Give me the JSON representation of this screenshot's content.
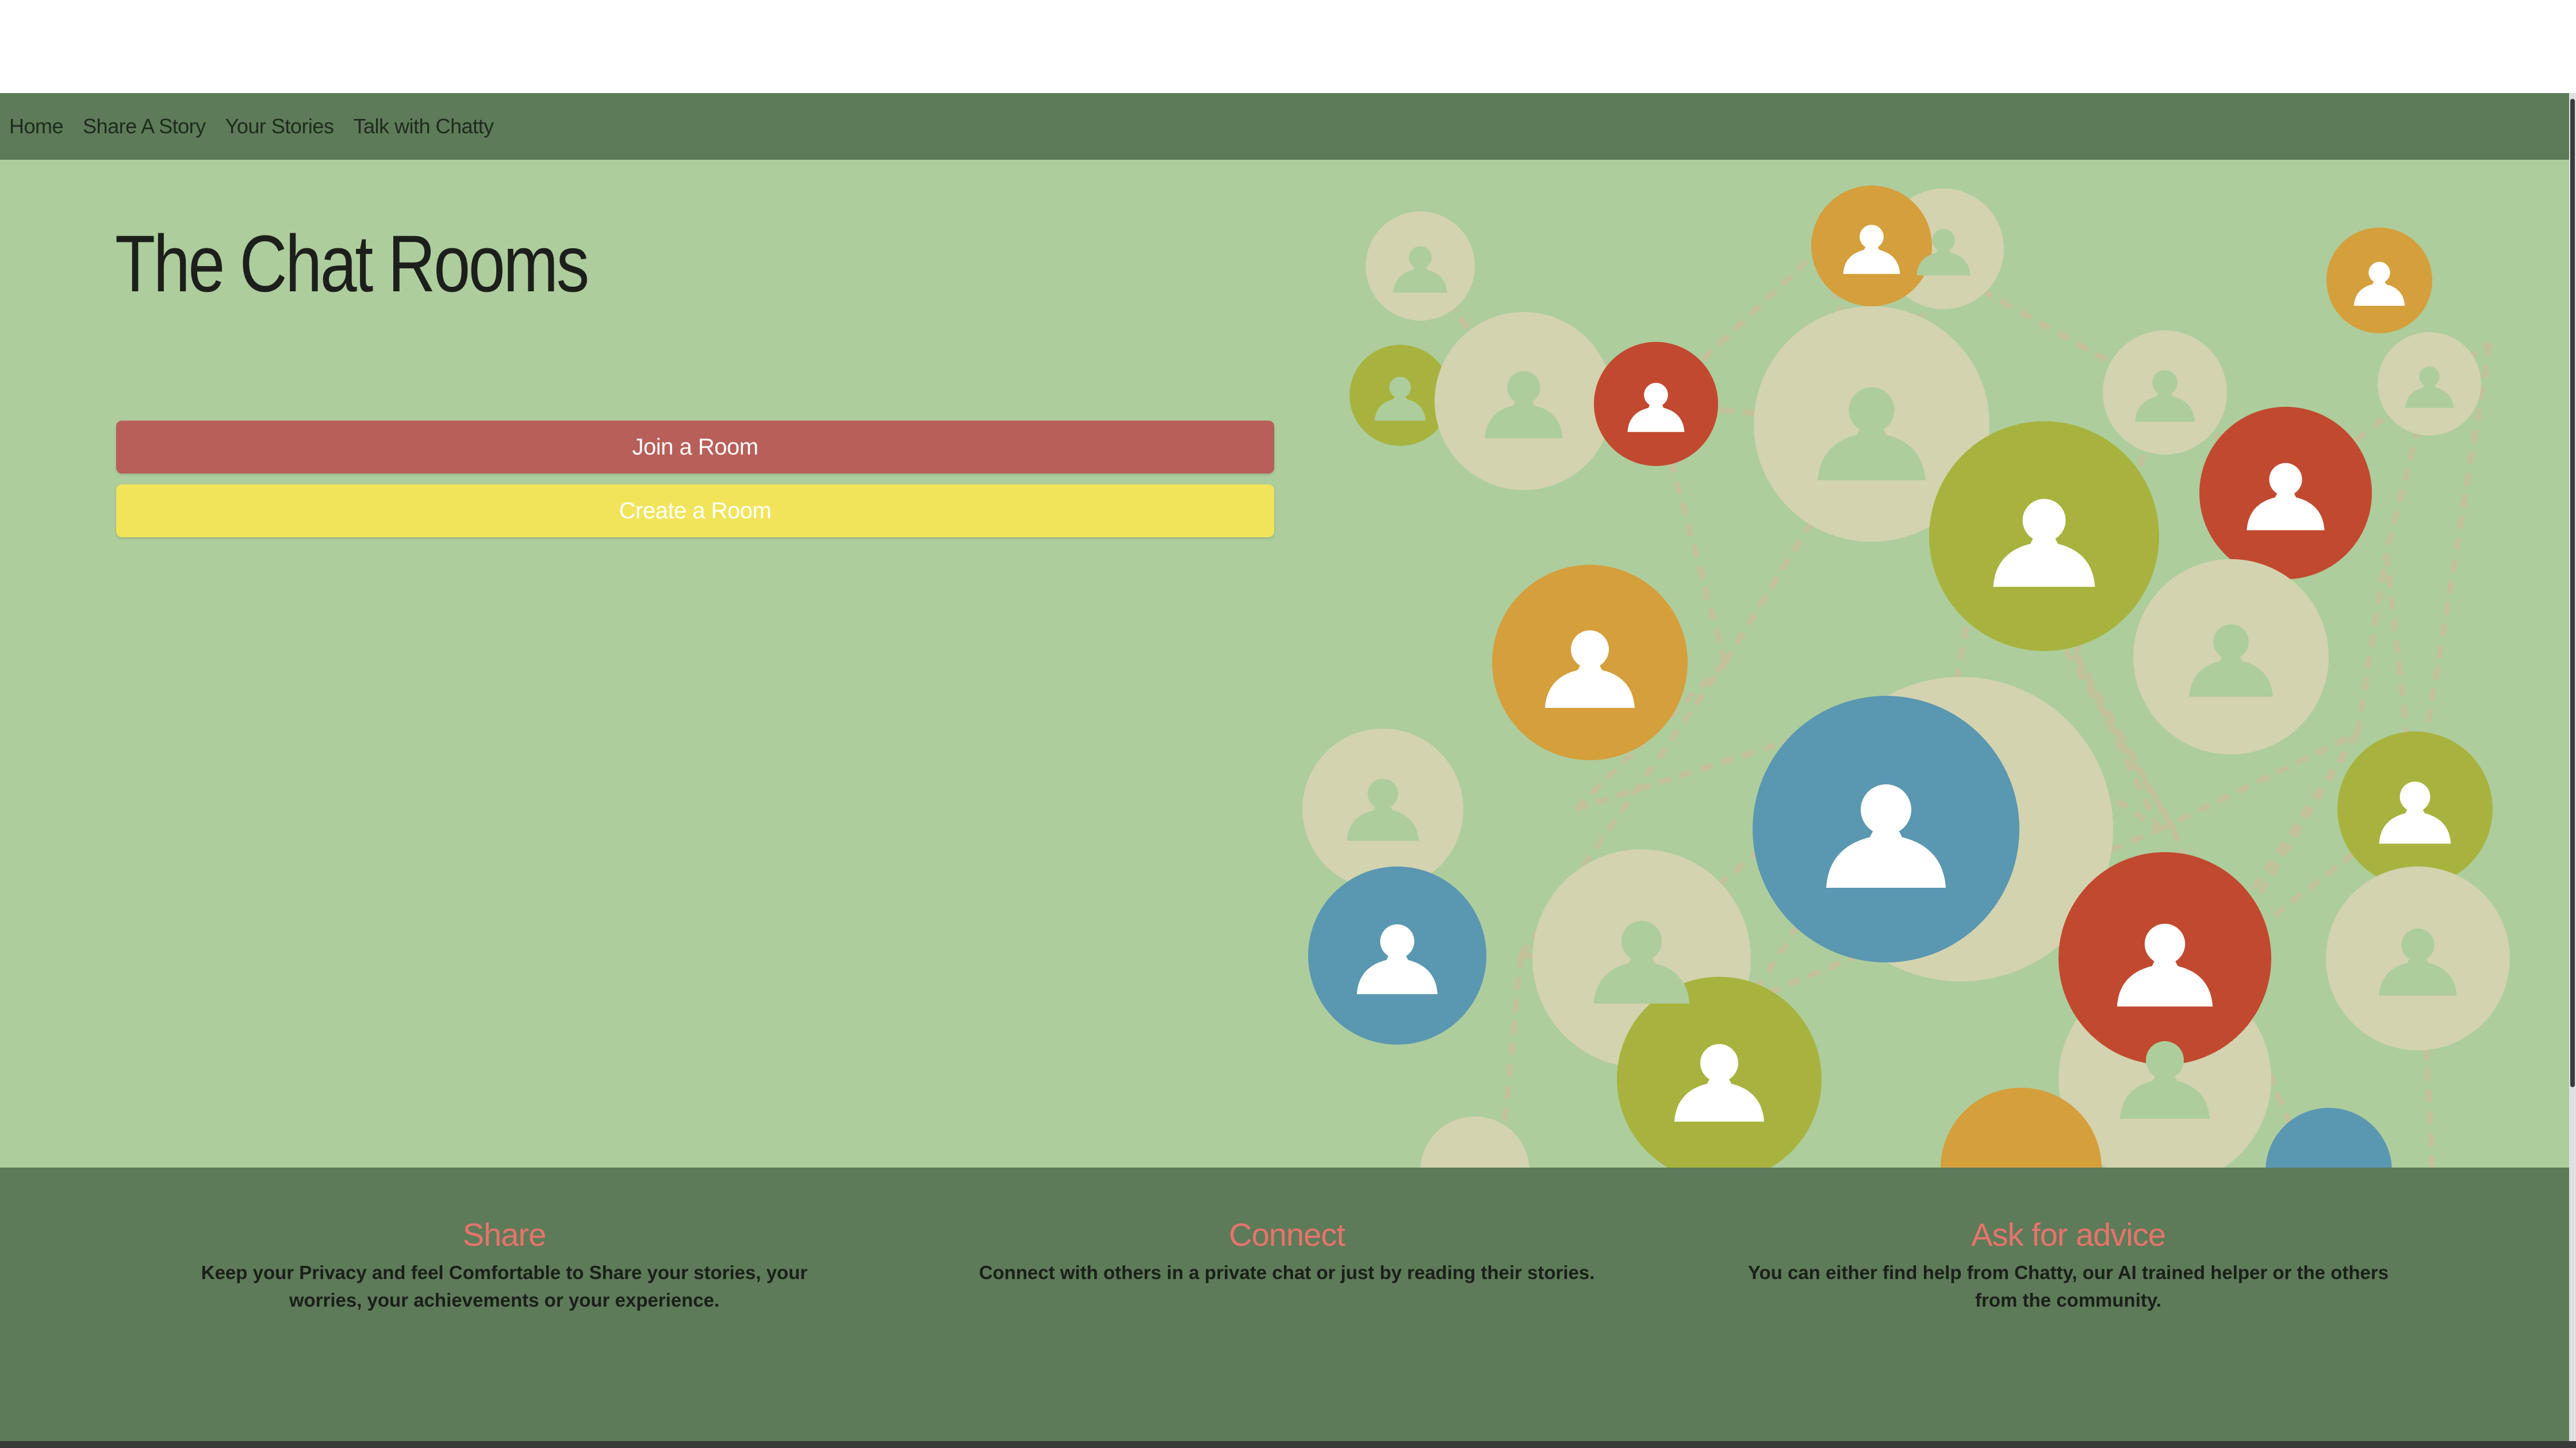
{
  "nav": {
    "items": [
      {
        "label": "Home"
      },
      {
        "label": "Share A Story"
      },
      {
        "label": "Your Stories"
      },
      {
        "label": "Talk with Chatty"
      }
    ]
  },
  "main": {
    "title": "The Chat Rooms",
    "join_button": "Join a Room",
    "create_button": "Create a Room"
  },
  "colors": {
    "navbar": "#5d7b58",
    "hero_background": "#adcd9c",
    "join_button": "#b85f59",
    "create_button": "#f2e45a",
    "feature_heading": "#e8736c"
  },
  "illustration": {
    "icon": "people-network-icon"
  },
  "footer": {
    "features": [
      {
        "title": "Share",
        "text": "Keep your Privacy and feel Comfortable to Share your stories, your worries, your achievements or your experience."
      },
      {
        "title": "Connect",
        "text": "Connect with others in a private chat or just by reading their stories."
      },
      {
        "title": "Ask for advice",
        "text": "You can either find help from Chatty, our AI trained helper or the others from the community."
      }
    ]
  }
}
